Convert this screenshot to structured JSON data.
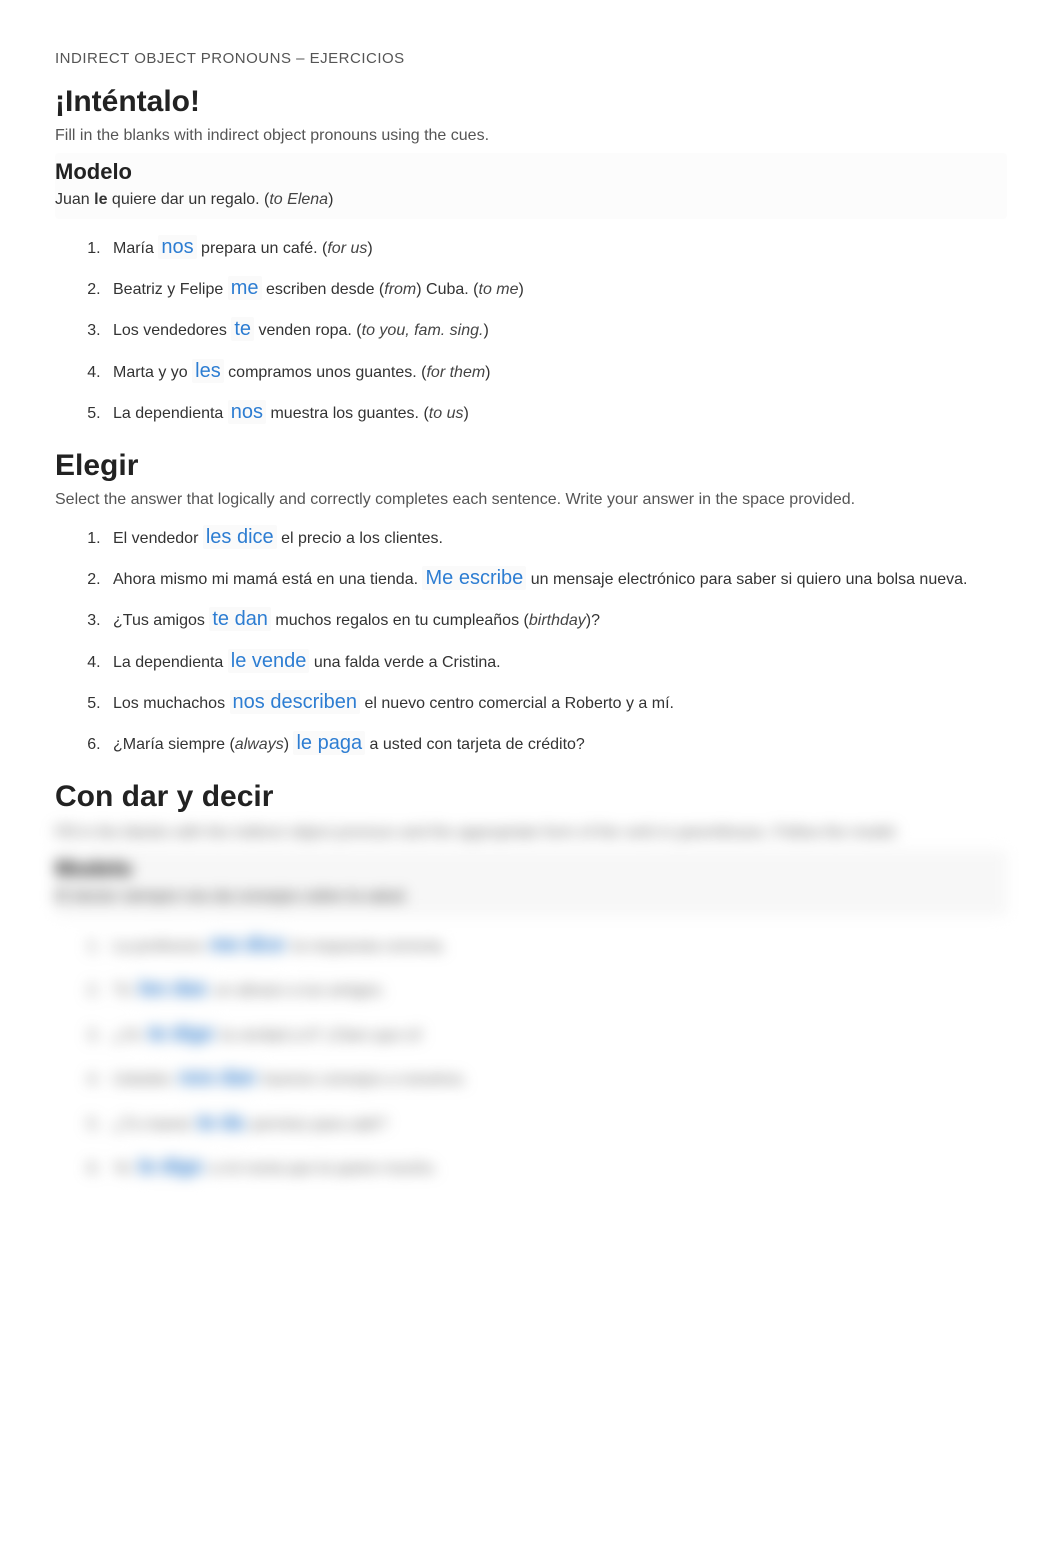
{
  "header": "INDIRECT OBJECT PRONOUNS – EJERCICIOS",
  "section1": {
    "title": "¡Inténtalo!",
    "instructions": "Fill in the blanks with indirect object pronouns using the cues.",
    "modelo_title": "Modelo",
    "modelo_pre": "Juan ",
    "modelo_bold": "le",
    "modelo_post": " quiere dar un regalo. (",
    "modelo_ital": "to Elena",
    "modelo_close": ")",
    "items": [
      {
        "pre": "María ",
        "ans": "nos",
        "post": " prepara un café. (",
        "ital": "for us",
        "close": ")"
      },
      {
        "pre": "Beatriz y Felipe ",
        "ans": "me",
        "post": " escriben desde (",
        "ital1": "from",
        "mid": ") Cuba. (",
        "ital2": "to me",
        "close": ")"
      },
      {
        "pre": "Los vendedores ",
        "ans": "te",
        "post": " venden ropa. (",
        "ital": "to you, fam. sing.",
        "close": ")"
      },
      {
        "pre": "Marta y yo ",
        "ans": "les",
        "post": " compramos unos guantes. (",
        "ital": "for them",
        "close": ")"
      },
      {
        "pre": "La dependienta ",
        "ans": "nos",
        "post": " muestra los guantes. (",
        "ital": "to us",
        "close": ")"
      }
    ]
  },
  "section2": {
    "title": "Elegir",
    "instructions": "Select the answer that logically and correctly completes each sentence. Write your answer in the space provided.",
    "items": [
      {
        "pre": "El vendedor ",
        "ans": "les dice",
        "post": " el precio a los clientes."
      },
      {
        "pre": "Ahora mismo mi mamá está en una tienda. ",
        "ans": "Me escribe",
        "post": " un mensaje electrónico para saber si quiero una bolsa nueva."
      },
      {
        "pre": "¿Tus amigos ",
        "ans": "te dan",
        "post": " muchos regalos en tu cumpleaños (",
        "ital": "birthday",
        "close": ")?"
      },
      {
        "pre": "La dependienta ",
        "ans": "le vende",
        "post": " una falda verde a Cristina."
      },
      {
        "pre": "Los muchachos ",
        "ans": "nos describen",
        "post": " el nuevo centro comercial a Roberto y a mí."
      },
      {
        "pre": "¿María siempre (",
        "ital_pre": "always",
        "mid": ") ",
        "ans": "le paga",
        "post": " a usted con tarjeta de crédito?"
      }
    ]
  },
  "section3": {
    "title": "Con dar y decir",
    "instructions_a": "Fill in the blanks with the indirect object pronoun and the appropriate form of the verb in parentheses. Follow the model.",
    "modelo_title": "Modelo",
    "modelo_text": "El doctor siempre nos da consejos sobre la salud.",
    "items": [
      {
        "pre": "La profesora ",
        "ans": "me dice",
        "post": " la respuesta correcta."
      },
      {
        "pre": "Tú ",
        "ans": "les das",
        "post": " un abrazo a tus amigos."
      },
      {
        "pre": "¿Yo ",
        "ans": "te digo",
        "post": " la verdad a ti? ¡Claro que sí!"
      },
      {
        "pre": "Ustedes ",
        "ans": "nos dan",
        "post": " buenos consejos a nosotros."
      },
      {
        "pre": "¿Tu mamá ",
        "ans": "te da",
        "post": " permiso para salir?"
      },
      {
        "pre": "Yo ",
        "ans": "le digo",
        "post": " a mi novia que la quiero mucho."
      }
    ]
  }
}
